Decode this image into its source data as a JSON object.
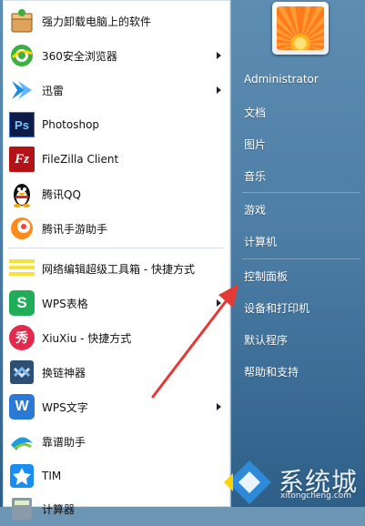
{
  "programs": [
    {
      "label": "强力卸载电脑上的软件",
      "icon": "uninstall-icon",
      "submenu": false
    },
    {
      "label": "360安全浏览器",
      "icon": "browser-360-icon",
      "submenu": true
    },
    {
      "label": "迅雷",
      "icon": "xunlei-icon",
      "submenu": true
    },
    {
      "label": "Photoshop",
      "icon": "photoshop-icon",
      "submenu": false
    },
    {
      "label": "FileZilla Client",
      "icon": "filezilla-icon",
      "submenu": false
    },
    {
      "label": "腾讯QQ",
      "icon": "qq-penguin-icon",
      "submenu": false
    },
    {
      "label": "腾讯手游助手",
      "icon": "tencent-game-assistant-icon",
      "submenu": false
    },
    {
      "label": "网络编辑超级工具箱 - 快捷方式",
      "icon": "toolbox-icon",
      "submenu": false
    },
    {
      "label": "WPS表格",
      "icon": "wps-spreadsheet-icon",
      "submenu": true
    },
    {
      "label": "XiuXiu - 快捷方式",
      "icon": "xiuxiu-icon",
      "submenu": false
    },
    {
      "label": "换链神器",
      "icon": "link-tool-icon",
      "submenu": false
    },
    {
      "label": "WPS文字",
      "icon": "wps-writer-icon",
      "submenu": true
    },
    {
      "label": "靠谱助手",
      "icon": "kaopu-assistant-icon",
      "submenu": false
    },
    {
      "label": "TIM",
      "icon": "tim-icon",
      "submenu": false
    },
    {
      "label": "计算器",
      "icon": "calculator-icon",
      "submenu": false
    }
  ],
  "icon_text": {
    "photoshop": "Ps",
    "filezilla": "Fz",
    "wps_spreadsheet": "S",
    "xiuxiu": "秀",
    "wps_writer": "W"
  },
  "right_menu": {
    "user": "Administrator",
    "documents": "文档",
    "pictures": "图片",
    "music": "音乐",
    "games": "游戏",
    "computer": "计算机",
    "control_panel": "控制面板",
    "devices_printers": "设备和打印机",
    "default_programs": "默认程序",
    "help_support": "帮助和支持"
  },
  "watermark": {
    "text": "系统城",
    "url": "xitongcheng.com"
  },
  "colors": {
    "arrow": "#e53935",
    "wps_green": "#1fae57",
    "wps_blue": "#2b79d6",
    "ps_blue": "#0c1b48",
    "filezilla_red": "#b31217"
  }
}
